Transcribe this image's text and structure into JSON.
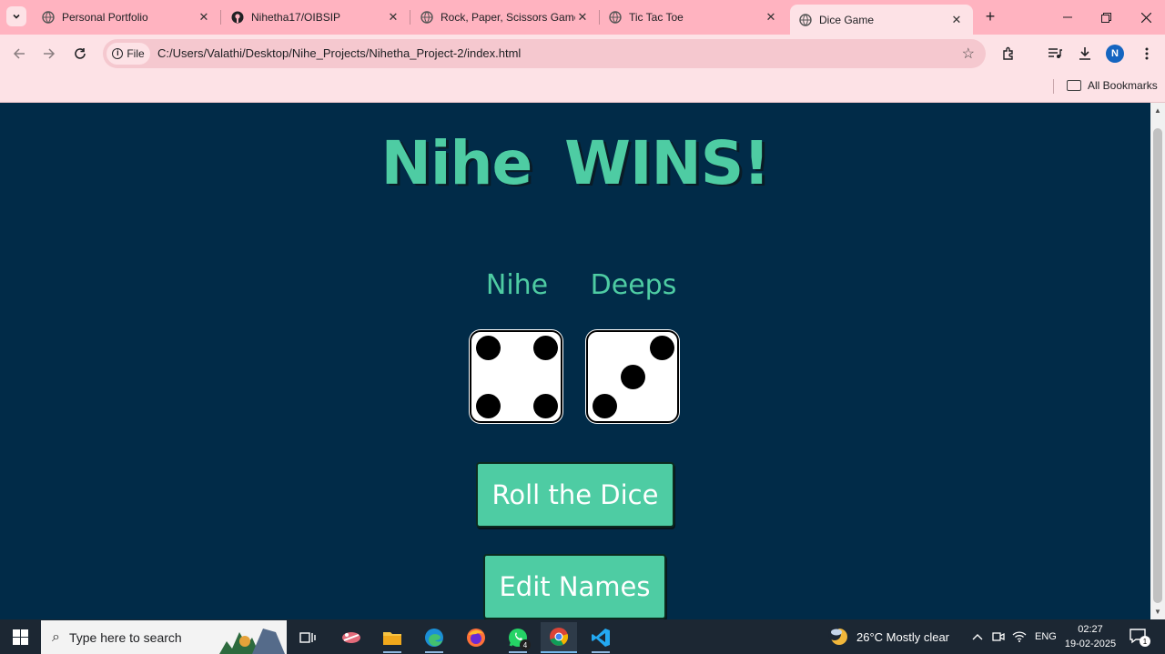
{
  "browser": {
    "tabs": [
      {
        "title": "Personal Portfolio",
        "favicon": "globe-icon",
        "active": false
      },
      {
        "title": "Nihetha17/OIBSIP",
        "favicon": "github-icon",
        "active": false
      },
      {
        "title": "Rock, Paper, Scissors Game",
        "favicon": "globe-icon",
        "active": false
      },
      {
        "title": "Tic Tac Toe",
        "favicon": "globe-icon",
        "active": false
      },
      {
        "title": "Dice Game",
        "favicon": "globe-icon",
        "active": true
      }
    ],
    "address": {
      "chip_label": "File",
      "url": "C:/Users/Valathi/Desktop/Nihe_Projects/Nihetha_Project-2/index.html"
    },
    "profile_initial": "N",
    "bookmarks_label": "All Bookmarks"
  },
  "game": {
    "headline": "Nihe WINS!",
    "player1": {
      "name": "Nihe",
      "dice_value": 4
    },
    "player2": {
      "name": "Deeps",
      "dice_value": 3
    },
    "roll_button": "Roll the Dice",
    "edit_button": "Edit Names"
  },
  "taskbar": {
    "search_placeholder": "Type here to search",
    "whatsapp_badge": "4",
    "weather": "26°C  Mostly clear",
    "language": "ENG",
    "time": "02:27",
    "date": "19-02-2025",
    "notification_count": "1"
  },
  "colors": {
    "page_bg": "#012b48",
    "accent": "#4ecca3",
    "browser_chrome": "#ffb3c0"
  }
}
